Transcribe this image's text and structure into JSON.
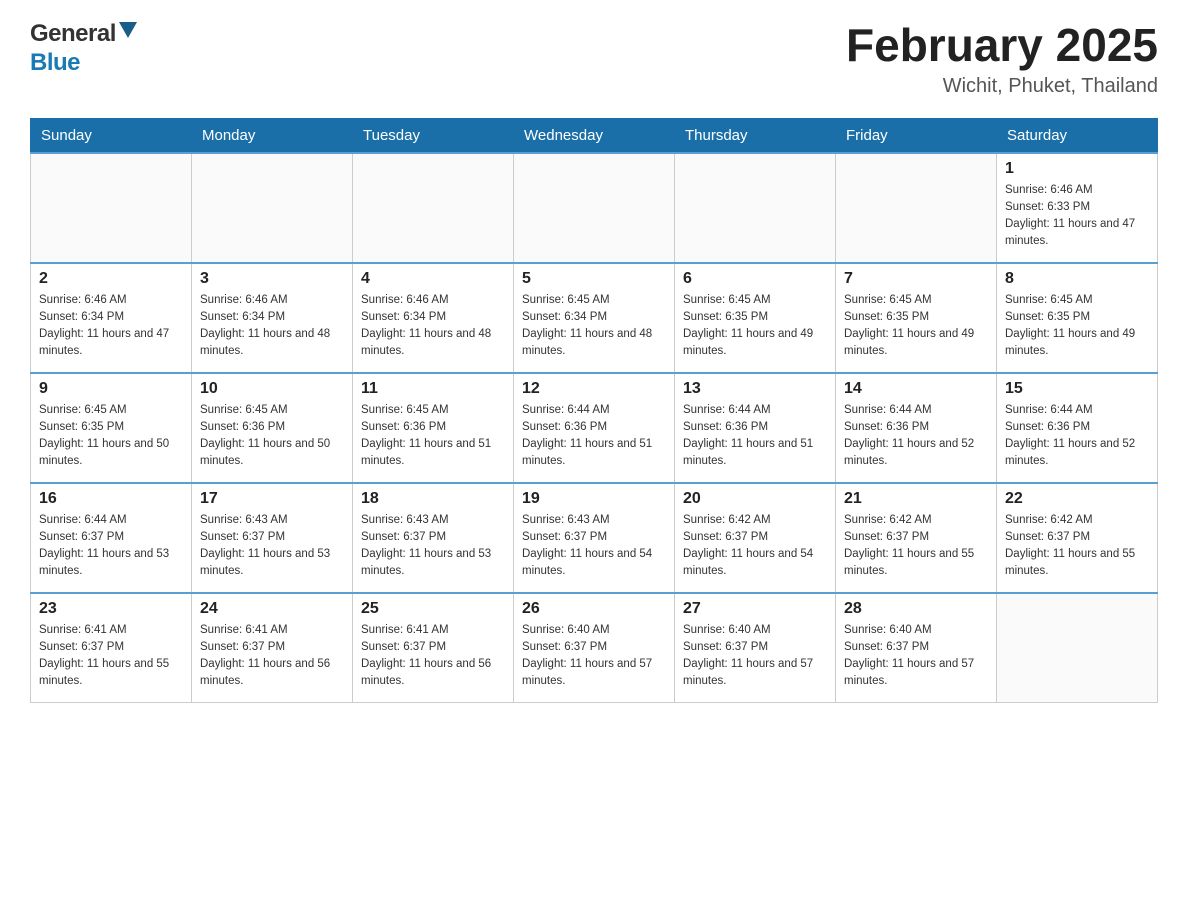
{
  "header": {
    "logo_general": "General",
    "logo_blue": "Blue",
    "title": "February 2025",
    "location": "Wichit, Phuket, Thailand"
  },
  "weekdays": [
    "Sunday",
    "Monday",
    "Tuesday",
    "Wednesday",
    "Thursday",
    "Friday",
    "Saturday"
  ],
  "weeks": [
    [
      {
        "day": "",
        "sunrise": "",
        "sunset": "",
        "daylight": ""
      },
      {
        "day": "",
        "sunrise": "",
        "sunset": "",
        "daylight": ""
      },
      {
        "day": "",
        "sunrise": "",
        "sunset": "",
        "daylight": ""
      },
      {
        "day": "",
        "sunrise": "",
        "sunset": "",
        "daylight": ""
      },
      {
        "day": "",
        "sunrise": "",
        "sunset": "",
        "daylight": ""
      },
      {
        "day": "",
        "sunrise": "",
        "sunset": "",
        "daylight": ""
      },
      {
        "day": "1",
        "sunrise": "Sunrise: 6:46 AM",
        "sunset": "Sunset: 6:33 PM",
        "daylight": "Daylight: 11 hours and 47 minutes."
      }
    ],
    [
      {
        "day": "2",
        "sunrise": "Sunrise: 6:46 AM",
        "sunset": "Sunset: 6:34 PM",
        "daylight": "Daylight: 11 hours and 47 minutes."
      },
      {
        "day": "3",
        "sunrise": "Sunrise: 6:46 AM",
        "sunset": "Sunset: 6:34 PM",
        "daylight": "Daylight: 11 hours and 48 minutes."
      },
      {
        "day": "4",
        "sunrise": "Sunrise: 6:46 AM",
        "sunset": "Sunset: 6:34 PM",
        "daylight": "Daylight: 11 hours and 48 minutes."
      },
      {
        "day": "5",
        "sunrise": "Sunrise: 6:45 AM",
        "sunset": "Sunset: 6:34 PM",
        "daylight": "Daylight: 11 hours and 48 minutes."
      },
      {
        "day": "6",
        "sunrise": "Sunrise: 6:45 AM",
        "sunset": "Sunset: 6:35 PM",
        "daylight": "Daylight: 11 hours and 49 minutes."
      },
      {
        "day": "7",
        "sunrise": "Sunrise: 6:45 AM",
        "sunset": "Sunset: 6:35 PM",
        "daylight": "Daylight: 11 hours and 49 minutes."
      },
      {
        "day": "8",
        "sunrise": "Sunrise: 6:45 AM",
        "sunset": "Sunset: 6:35 PM",
        "daylight": "Daylight: 11 hours and 49 minutes."
      }
    ],
    [
      {
        "day": "9",
        "sunrise": "Sunrise: 6:45 AM",
        "sunset": "Sunset: 6:35 PM",
        "daylight": "Daylight: 11 hours and 50 minutes."
      },
      {
        "day": "10",
        "sunrise": "Sunrise: 6:45 AM",
        "sunset": "Sunset: 6:36 PM",
        "daylight": "Daylight: 11 hours and 50 minutes."
      },
      {
        "day": "11",
        "sunrise": "Sunrise: 6:45 AM",
        "sunset": "Sunset: 6:36 PM",
        "daylight": "Daylight: 11 hours and 51 minutes."
      },
      {
        "day": "12",
        "sunrise": "Sunrise: 6:44 AM",
        "sunset": "Sunset: 6:36 PM",
        "daylight": "Daylight: 11 hours and 51 minutes."
      },
      {
        "day": "13",
        "sunrise": "Sunrise: 6:44 AM",
        "sunset": "Sunset: 6:36 PM",
        "daylight": "Daylight: 11 hours and 51 minutes."
      },
      {
        "day": "14",
        "sunrise": "Sunrise: 6:44 AM",
        "sunset": "Sunset: 6:36 PM",
        "daylight": "Daylight: 11 hours and 52 minutes."
      },
      {
        "day": "15",
        "sunrise": "Sunrise: 6:44 AM",
        "sunset": "Sunset: 6:36 PM",
        "daylight": "Daylight: 11 hours and 52 minutes."
      }
    ],
    [
      {
        "day": "16",
        "sunrise": "Sunrise: 6:44 AM",
        "sunset": "Sunset: 6:37 PM",
        "daylight": "Daylight: 11 hours and 53 minutes."
      },
      {
        "day": "17",
        "sunrise": "Sunrise: 6:43 AM",
        "sunset": "Sunset: 6:37 PM",
        "daylight": "Daylight: 11 hours and 53 minutes."
      },
      {
        "day": "18",
        "sunrise": "Sunrise: 6:43 AM",
        "sunset": "Sunset: 6:37 PM",
        "daylight": "Daylight: 11 hours and 53 minutes."
      },
      {
        "day": "19",
        "sunrise": "Sunrise: 6:43 AM",
        "sunset": "Sunset: 6:37 PM",
        "daylight": "Daylight: 11 hours and 54 minutes."
      },
      {
        "day": "20",
        "sunrise": "Sunrise: 6:42 AM",
        "sunset": "Sunset: 6:37 PM",
        "daylight": "Daylight: 11 hours and 54 minutes."
      },
      {
        "day": "21",
        "sunrise": "Sunrise: 6:42 AM",
        "sunset": "Sunset: 6:37 PM",
        "daylight": "Daylight: 11 hours and 55 minutes."
      },
      {
        "day": "22",
        "sunrise": "Sunrise: 6:42 AM",
        "sunset": "Sunset: 6:37 PM",
        "daylight": "Daylight: 11 hours and 55 minutes."
      }
    ],
    [
      {
        "day": "23",
        "sunrise": "Sunrise: 6:41 AM",
        "sunset": "Sunset: 6:37 PM",
        "daylight": "Daylight: 11 hours and 55 minutes."
      },
      {
        "day": "24",
        "sunrise": "Sunrise: 6:41 AM",
        "sunset": "Sunset: 6:37 PM",
        "daylight": "Daylight: 11 hours and 56 minutes."
      },
      {
        "day": "25",
        "sunrise": "Sunrise: 6:41 AM",
        "sunset": "Sunset: 6:37 PM",
        "daylight": "Daylight: 11 hours and 56 minutes."
      },
      {
        "day": "26",
        "sunrise": "Sunrise: 6:40 AM",
        "sunset": "Sunset: 6:37 PM",
        "daylight": "Daylight: 11 hours and 57 minutes."
      },
      {
        "day": "27",
        "sunrise": "Sunrise: 6:40 AM",
        "sunset": "Sunset: 6:37 PM",
        "daylight": "Daylight: 11 hours and 57 minutes."
      },
      {
        "day": "28",
        "sunrise": "Sunrise: 6:40 AM",
        "sunset": "Sunset: 6:37 PM",
        "daylight": "Daylight: 11 hours and 57 minutes."
      },
      {
        "day": "",
        "sunrise": "",
        "sunset": "",
        "daylight": ""
      }
    ]
  ],
  "colors": {
    "header_bg": "#1a6fa8",
    "header_text": "#ffffff",
    "border_row": "#5a9fd4",
    "border_cell": "#cccccc"
  }
}
